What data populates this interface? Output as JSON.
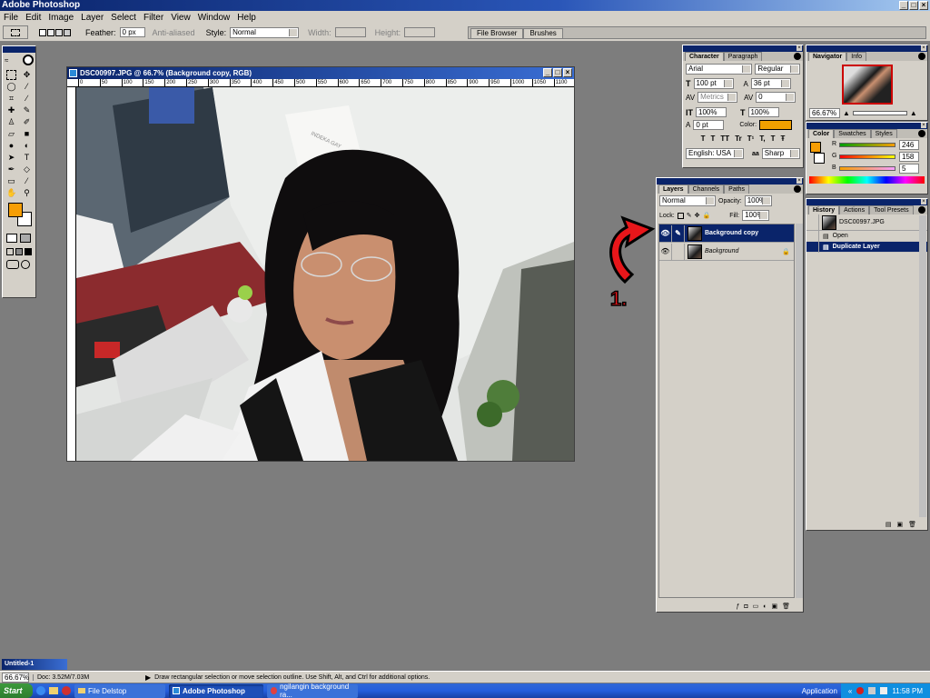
{
  "app": {
    "title": "Adobe Photoshop",
    "window_buttons": [
      "_",
      "□",
      "×"
    ]
  },
  "menu": [
    "File",
    "Edit",
    "Image",
    "Layer",
    "Select",
    "Filter",
    "View",
    "Window",
    "Help"
  ],
  "options": {
    "feather_label": "Feather:",
    "feather_value": "0 px",
    "antialiased": "Anti-aliased",
    "style_label": "Style:",
    "style_value": "Normal",
    "width_label": "Width:",
    "height_label": "Height:"
  },
  "well_tabs": [
    "File Browser",
    "Brushes"
  ],
  "document": {
    "title": "DSC00997.JPG @ 66.7% (Background copy, RGB)",
    "ruler": [
      "0",
      "50",
      "100",
      "150",
      "200",
      "250",
      "300",
      "350",
      "400",
      "450",
      "500",
      "550",
      "600",
      "650",
      "700",
      "750",
      "800",
      "850",
      "900",
      "950",
      "1000",
      "1050",
      "1100",
      "1150",
      "1200",
      "1250"
    ]
  },
  "image_text": "INDEKA GAY",
  "character": {
    "tabs": [
      "Character",
      "Paragraph"
    ],
    "font": "Arial",
    "style": "Regular",
    "size": "100 pt",
    "leading": "36 pt",
    "kerning": "Metrics",
    "tracking": "0",
    "vscale": "100%",
    "hscale": "100%",
    "baseline": "0 pt",
    "color_label": "Color:",
    "color": "#f0a000",
    "styles": [
      "T",
      "T",
      "TT",
      "Tr",
      "T¹",
      "T,",
      "T",
      "Ŧ"
    ],
    "language": "English: USA",
    "aa_label": "aa",
    "antialias": "Sharp"
  },
  "navigator": {
    "tabs": [
      "Navigator",
      "Info"
    ],
    "zoom": "66.67%"
  },
  "color": {
    "tabs": [
      "Color",
      "Swatches",
      "Styles"
    ],
    "r_label": "R",
    "g_label": "G",
    "b_label": "B",
    "r": "246",
    "g": "158",
    "b": "5",
    "fg": "#f69e05"
  },
  "layers": {
    "tabs": [
      "Layers",
      "Channels",
      "Paths"
    ],
    "mode": "Normal",
    "opacity_label": "Opacity:",
    "opacity": "100%",
    "lock_label": "Lock:",
    "fill_label": "Fill:",
    "fill": "100%",
    "rows": [
      {
        "name": "Background copy",
        "selected": true
      },
      {
        "name": "Background",
        "selected": false
      }
    ]
  },
  "history": {
    "tabs": [
      "History",
      "Actions",
      "Tool Presets"
    ],
    "snapshot": "DSC00997.JPG",
    "rows": [
      {
        "name": "Open",
        "selected": false
      },
      {
        "name": "Duplicate Layer",
        "selected": true
      }
    ]
  },
  "annotation": "1.",
  "mini_window": {
    "title": "Untitled-1"
  },
  "status": {
    "zoom": "66.67%",
    "doc": "Doc: 3.52M/7.03M",
    "hint": "Draw rectangular selection or move selection outline. Use Shift, Alt, and Ctrl for additional options."
  },
  "taskbar": {
    "start": "Start",
    "items": [
      {
        "label": "File Delstop",
        "active": false
      },
      {
        "label": "Adobe Photoshop",
        "active": true
      },
      {
        "label": "ngilangin background ra...",
        "active": false
      }
    ],
    "tray_label": "Application",
    "clock": "11:58 PM"
  }
}
